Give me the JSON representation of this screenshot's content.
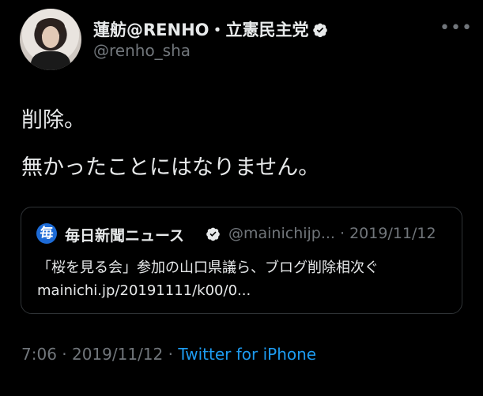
{
  "author": {
    "name": "蓮舫@RENHO・立憲民主党",
    "handle": "@renho_sha",
    "avatar_icon": "profile-photo",
    "verified_icon": "verified-badge-icon"
  },
  "menu": {
    "more_label": "•••"
  },
  "tweet": {
    "lines": [
      "削除。",
      "無かったことにはなりません。"
    ]
  },
  "quoted_card": {
    "logo_glyph": "毎",
    "source_name": "毎日新聞ニュース",
    "source_handle_date": "@mainichijp... · 2019/11/12",
    "title": "「桜を見る会」参加の山口県議ら、ブログ削除相次ぐ",
    "url": "mainichi.jp/20191111/k00/0..."
  },
  "meta": {
    "time_date": "7:06 · 2019/11/12 · ",
    "app": "Twitter for iPhone"
  },
  "colors": {
    "background": "#000000",
    "text": "#e7e9ea",
    "secondary": "#71767b",
    "link": "#1d9bf0",
    "border": "#2f3336"
  }
}
